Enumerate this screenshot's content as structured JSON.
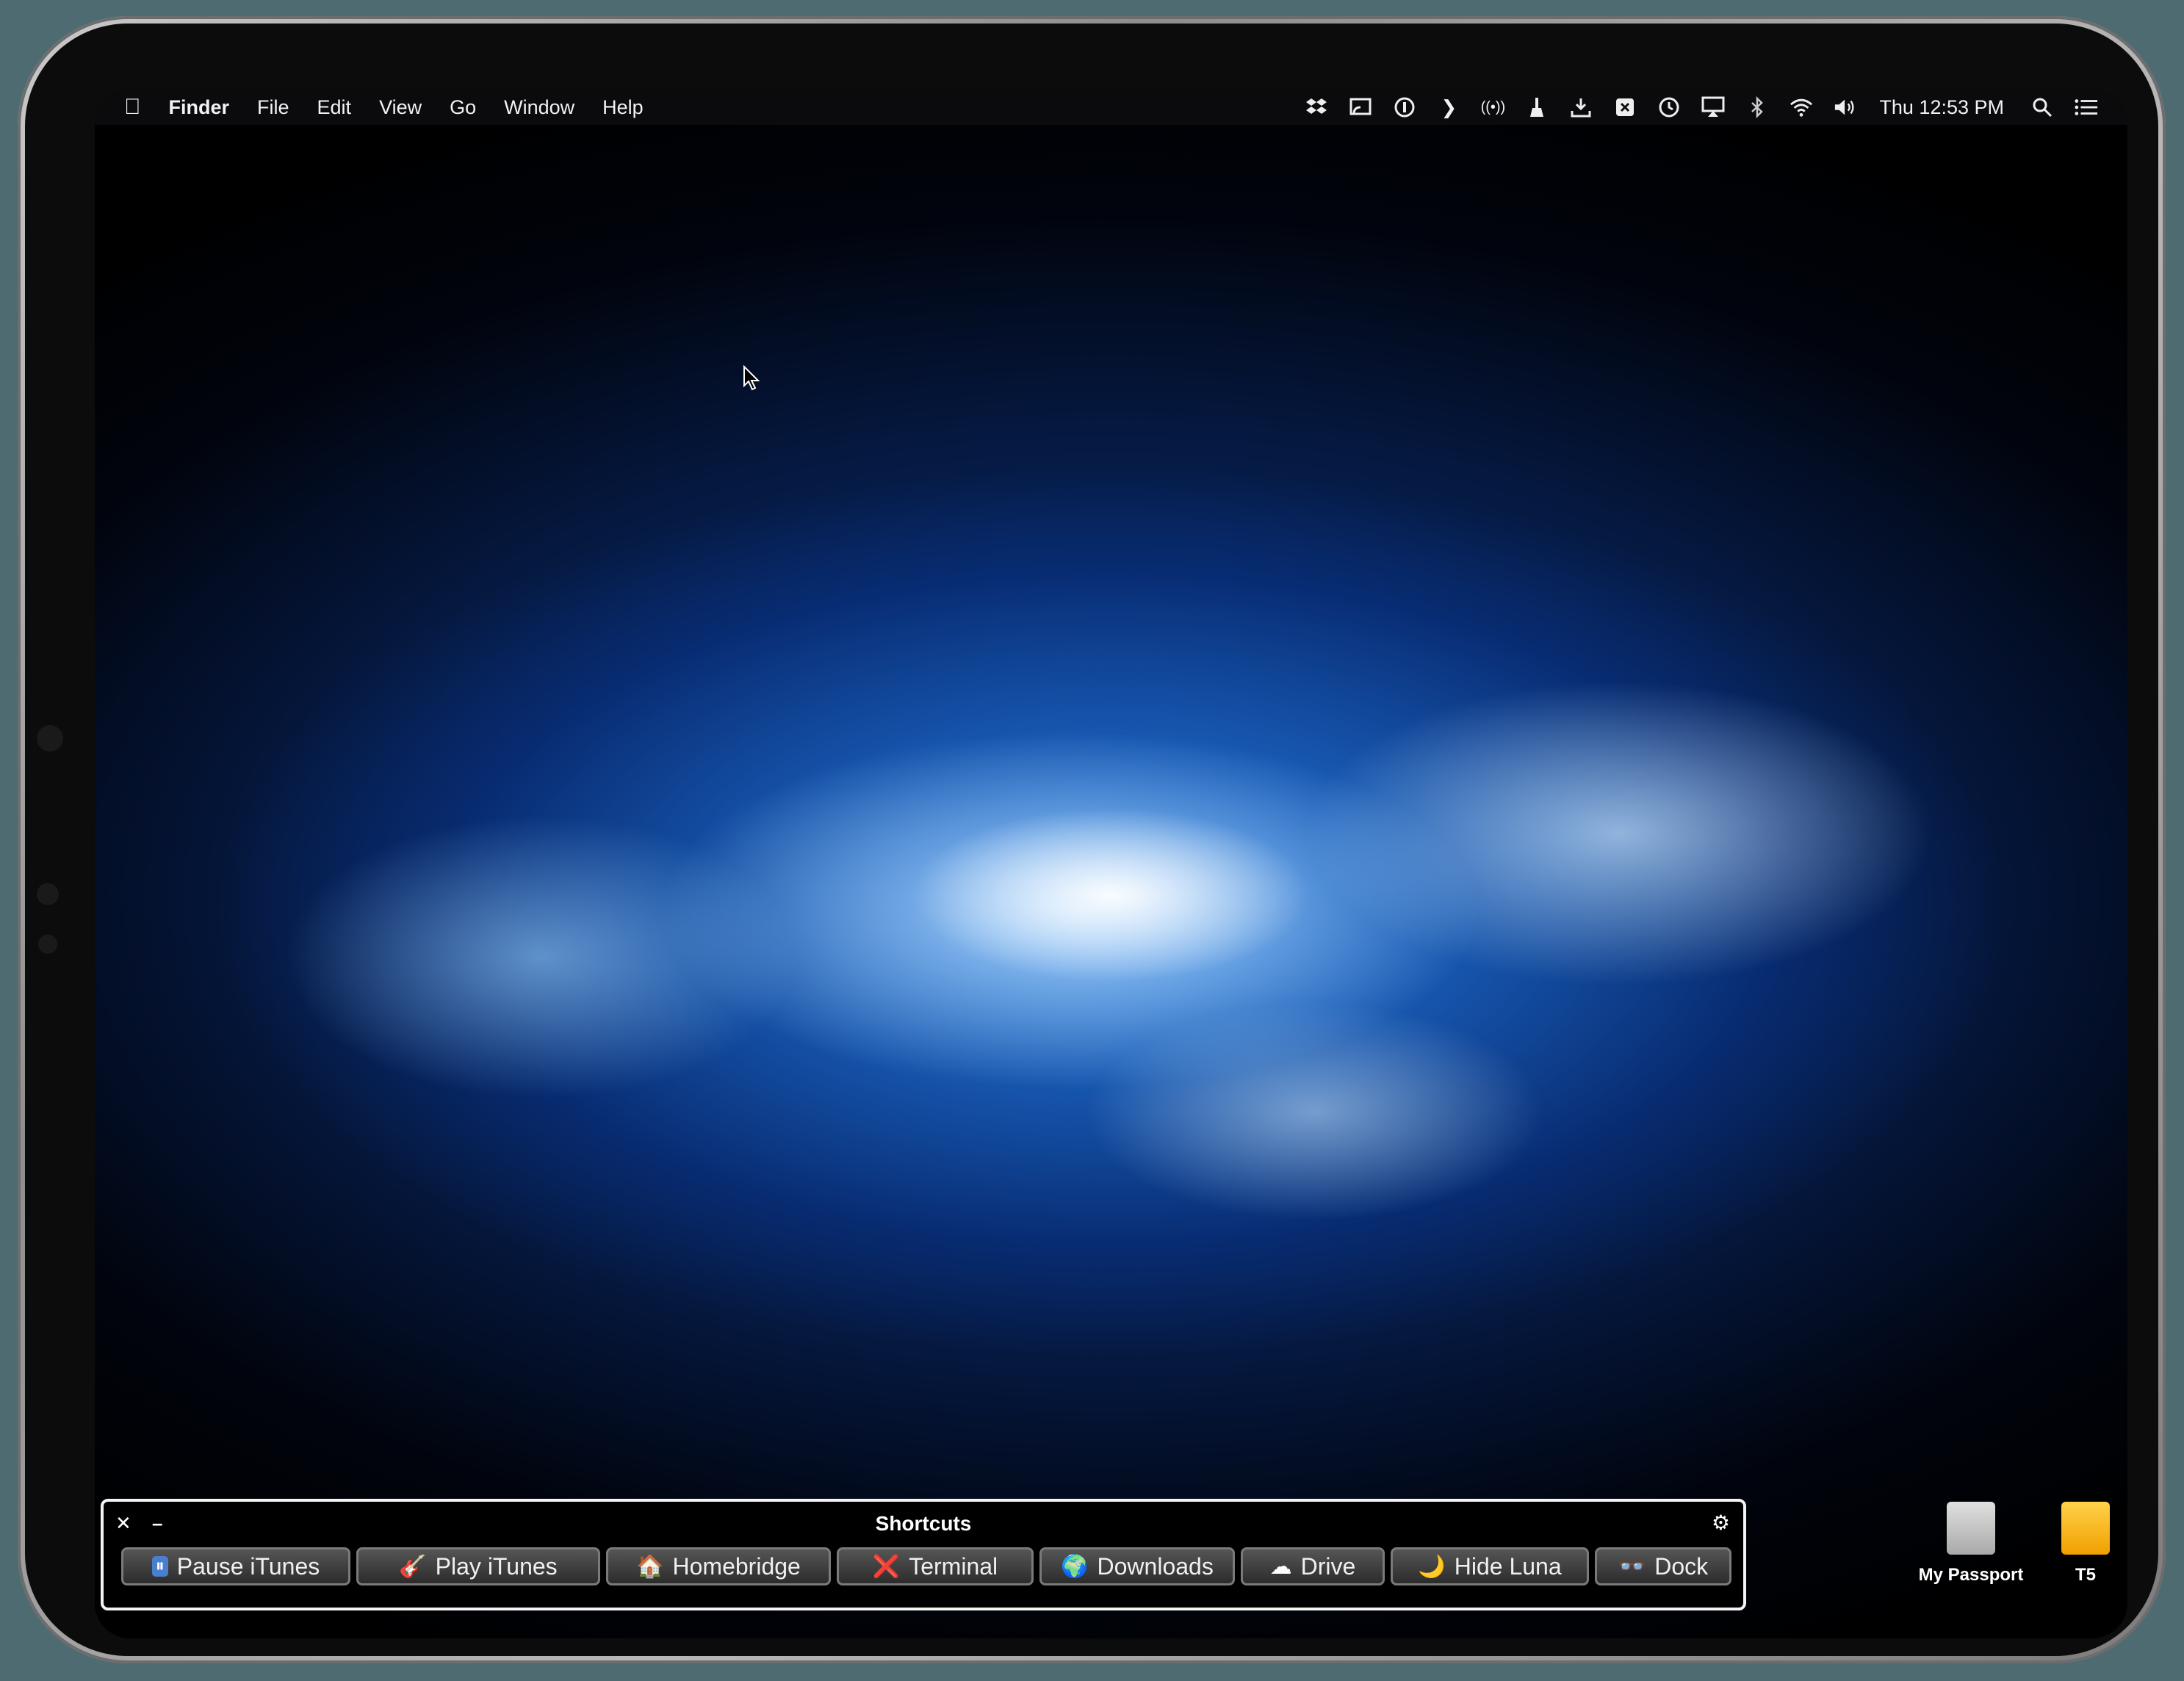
{
  "menubar": {
    "apple_icon": "apple-logo",
    "app_name": "Finder",
    "menus": [
      "File",
      "Edit",
      "View",
      "Go",
      "Window",
      "Help"
    ],
    "status_icons": [
      "dropbox-icon",
      "cast-icon",
      "1password-icon",
      "prompt-icon",
      "broadcast-icon",
      "cleaner-icon",
      "download-icon",
      "inbox-download-icon",
      "command-icon",
      "time-machine-icon",
      "airplay-icon",
      "bluetooth-icon",
      "wifi-icon",
      "volume-icon"
    ],
    "clock": "Thu 12:53 PM",
    "search_icon": "search-icon",
    "notification_icon": "list-icon"
  },
  "shortcuts": {
    "title": "Shortcuts",
    "close_glyph": "✕",
    "minimize_glyph": "–",
    "gear_glyph": "⚙",
    "buttons": [
      {
        "emoji": "⏸",
        "label": "Pause iTunes"
      },
      {
        "emoji": "🎸",
        "label": "Play iTunes"
      },
      {
        "emoji": "🏠",
        "label": "Homebridge"
      },
      {
        "emoji": "❌",
        "label": "Terminal"
      },
      {
        "emoji": "🌍",
        "label": "Downloads"
      },
      {
        "emoji": "☁",
        "label": "Drive"
      },
      {
        "emoji": "🌙",
        "label": "Hide Luna"
      },
      {
        "emoji": "👓",
        "label": "Dock"
      }
    ]
  },
  "desktop": {
    "disks": [
      {
        "label": "My Passport",
        "color": "#c8c8c8"
      },
      {
        "label": "T5",
        "color": "#f4b400"
      }
    ]
  }
}
